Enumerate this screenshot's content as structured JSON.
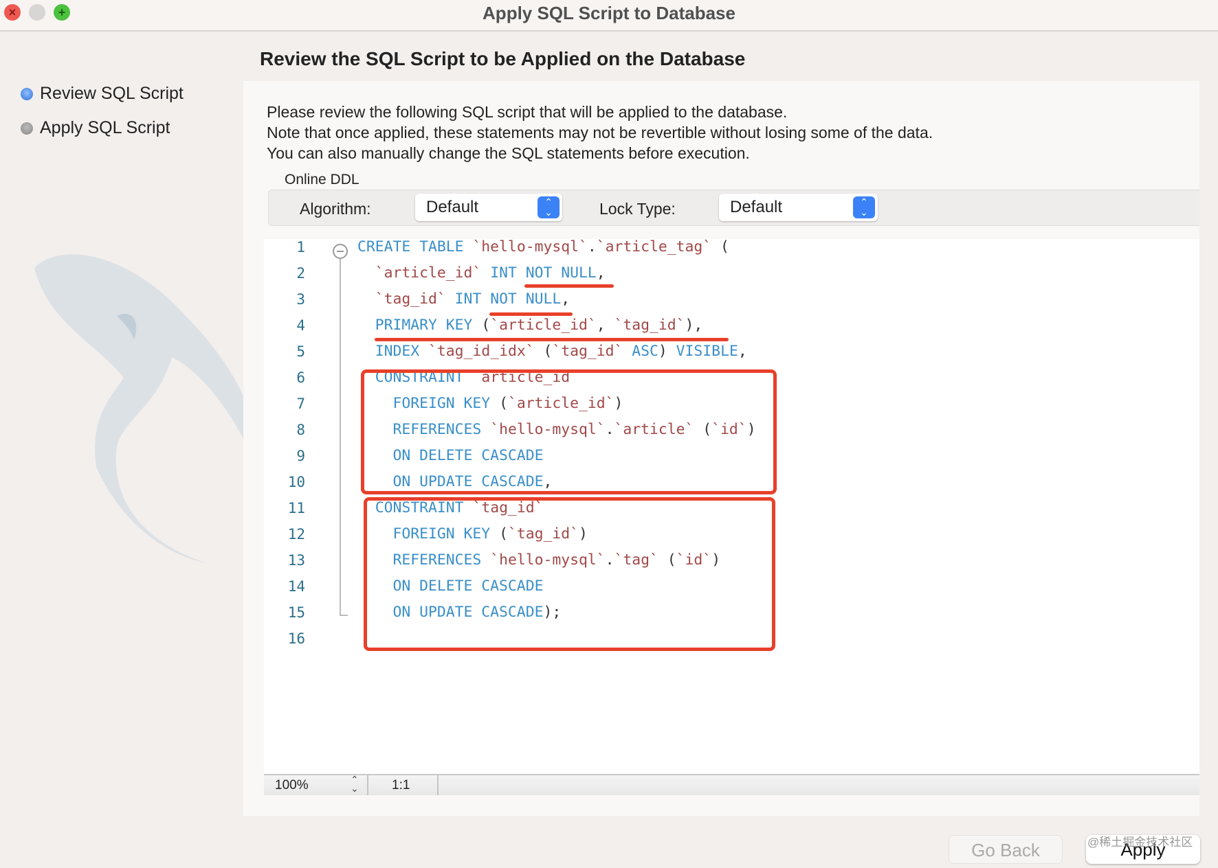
{
  "window": {
    "title": "Apply SQL Script to Database"
  },
  "header": {
    "title": "Review the SQL Script to be Applied on the Database"
  },
  "sidebar": {
    "items": [
      {
        "label": "Review SQL Script",
        "state": "active"
      },
      {
        "label": "Apply SQL Script",
        "state": "pending"
      }
    ]
  },
  "description": [
    "Please review the following SQL script that will be applied to the database.",
    "Note that once applied, these statements may not be revertible without losing some of the data.",
    "You can also manually change the SQL statements before execution."
  ],
  "online_ddl": {
    "title": "Online DDL",
    "algorithm_label": "Algorithm:",
    "algorithm_value": "Default",
    "lock_label": "Lock Type:",
    "lock_value": "Default"
  },
  "editor": {
    "lines": [
      [
        [
          "kw",
          "CREATE TABLE "
        ],
        [
          "str",
          "`hello-mysql`"
        ],
        [
          "pn",
          "."
        ],
        [
          "str",
          "`article_tag`"
        ],
        [
          "pn",
          " ("
        ]
      ],
      [
        [
          "pn",
          "  "
        ],
        [
          "str",
          "`article_id`"
        ],
        [
          "kw",
          " INT NOT NULL"
        ],
        [
          "pn",
          ","
        ]
      ],
      [
        [
          "pn",
          "  "
        ],
        [
          "str",
          "`tag_id`"
        ],
        [
          "kw",
          " INT NOT NULL"
        ],
        [
          "pn",
          ","
        ]
      ],
      [
        [
          "pn",
          "  "
        ],
        [
          "kw",
          "PRIMARY KEY"
        ],
        [
          "pn",
          " ("
        ],
        [
          "str",
          "`article_id`"
        ],
        [
          "pn",
          ", "
        ],
        [
          "str",
          "`tag_id`"
        ],
        [
          "pn",
          "),"
        ]
      ],
      [
        [
          "pn",
          "  "
        ],
        [
          "kw",
          "INDEX "
        ],
        [
          "str",
          "`tag_id_idx`"
        ],
        [
          "pn",
          " ("
        ],
        [
          "str",
          "`tag_id`"
        ],
        [
          "kw",
          " ASC"
        ],
        [
          "pn",
          ") "
        ],
        [
          "kw",
          "VISIBLE"
        ],
        [
          "pn",
          ","
        ]
      ],
      [
        [
          "pn",
          "  "
        ],
        [
          "kw",
          "CONSTRAINT "
        ],
        [
          "str",
          "`article_id`"
        ]
      ],
      [
        [
          "pn",
          "    "
        ],
        [
          "kw",
          "FOREIGN KEY"
        ],
        [
          "pn",
          " ("
        ],
        [
          "str",
          "`article_id`"
        ],
        [
          "pn",
          ")"
        ]
      ],
      [
        [
          "pn",
          "    "
        ],
        [
          "kw",
          "REFERENCES "
        ],
        [
          "str",
          "`hello-mysql`"
        ],
        [
          "pn",
          "."
        ],
        [
          "str",
          "`article`"
        ],
        [
          "pn",
          " ("
        ],
        [
          "str",
          "`id`"
        ],
        [
          "pn",
          ")"
        ]
      ],
      [
        [
          "pn",
          "    "
        ],
        [
          "kw",
          "ON DELETE CASCADE"
        ]
      ],
      [
        [
          "pn",
          "    "
        ],
        [
          "kw",
          "ON UPDATE CASCADE"
        ],
        [
          "pn",
          ","
        ]
      ],
      [
        [
          "pn",
          "  "
        ],
        [
          "kw",
          "CONSTRAINT "
        ],
        [
          "str",
          "`tag_id`"
        ]
      ],
      [
        [
          "pn",
          "    "
        ],
        [
          "kw",
          "FOREIGN KEY"
        ],
        [
          "pn",
          " ("
        ],
        [
          "str",
          "`tag_id`"
        ],
        [
          "pn",
          ")"
        ]
      ],
      [
        [
          "pn",
          "    "
        ],
        [
          "kw",
          "REFERENCES "
        ],
        [
          "str",
          "`hello-mysql`"
        ],
        [
          "pn",
          "."
        ],
        [
          "str",
          "`tag`"
        ],
        [
          "pn",
          " ("
        ],
        [
          "str",
          "`id`"
        ],
        [
          "pn",
          ")"
        ]
      ],
      [
        [
          "pn",
          "    "
        ],
        [
          "kw",
          "ON DELETE CASCADE"
        ]
      ],
      [
        [
          "pn",
          "    "
        ],
        [
          "kw",
          "ON UPDATE CASCADE"
        ],
        [
          "pn",
          ");"
        ]
      ],
      []
    ]
  },
  "statusbar": {
    "zoom": "100%",
    "position": "1:1"
  },
  "buttons": {
    "back": "Go Back",
    "apply": "Apply"
  },
  "watermark": "@稀土掘金技术社区",
  "colors": {
    "annotation": "#e8402a",
    "keyword": "#3a8fc9",
    "string": "#a24848",
    "accent": "#3b82f6"
  }
}
